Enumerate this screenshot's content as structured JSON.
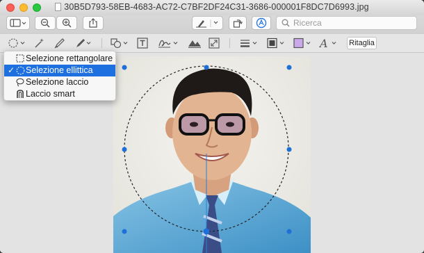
{
  "window": {
    "title": "30B5D793-58EB-4683-AC72-C7BF2DF24C31-3686-000001F8DC7D6993.jpg"
  },
  "toolbar": {
    "search_placeholder": "Ricerca",
    "crop_label": "Ritaglia"
  },
  "selection_menu": {
    "items": [
      {
        "label": "Selezione rettangolare",
        "icon": "rect-selection-icon",
        "selected": false
      },
      {
        "label": "Selezione ellittica",
        "icon": "ellipse-selection-icon",
        "selected": true
      },
      {
        "label": "Selezione laccio",
        "icon": "lasso-icon",
        "selected": false
      },
      {
        "label": "Laccio smart",
        "icon": "smart-lasso-icon",
        "selected": false
      }
    ]
  },
  "colors": {
    "menu_highlight": "#1e6fe0",
    "handle": "#1f6fd8"
  }
}
